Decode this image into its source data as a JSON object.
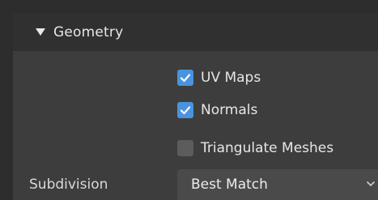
{
  "panel": {
    "title": "Geometry",
    "expanded": true
  },
  "options": [
    {
      "label": "UV Maps",
      "checked": true
    },
    {
      "label": "Normals",
      "checked": true
    },
    {
      "label": "Triangulate Meshes",
      "checked": false
    }
  ],
  "subdivision": {
    "label": "Subdivision",
    "value": "Best Match"
  },
  "colors": {
    "accent": "#4a93e0"
  }
}
